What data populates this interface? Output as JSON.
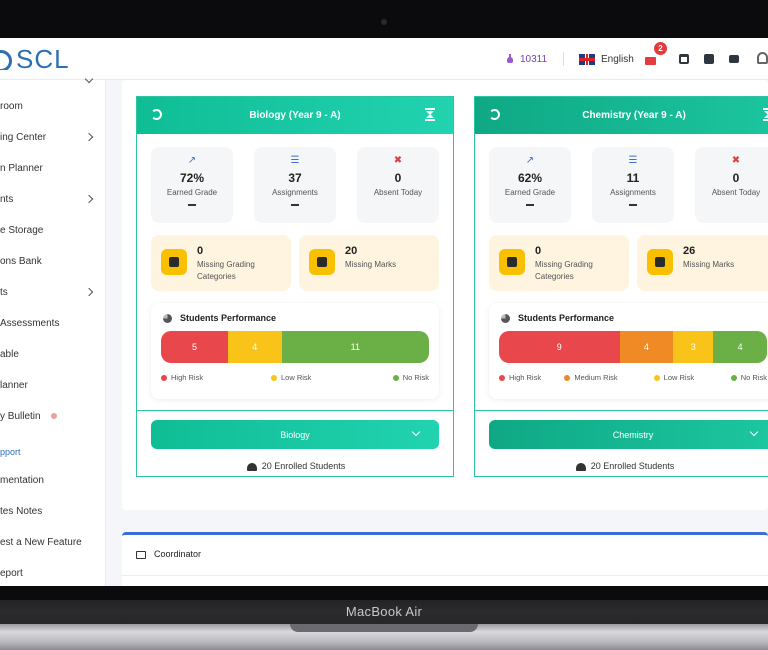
{
  "device": {
    "label": "MacBook Air"
  },
  "header": {
    "logo": "SCL",
    "points": "10311",
    "language": "English",
    "notifications": "2"
  },
  "sidebar": {
    "items": [
      "room",
      "ing Center",
      "n Planner",
      "nts",
      "e Storage",
      "ons Bank",
      "ts",
      "Assessments",
      "able",
      "lanner",
      "y Bulletin"
    ],
    "section": "pport",
    "support_items": [
      "mentation",
      "tes Notes",
      "est a New Feature",
      "eport"
    ]
  },
  "courses": [
    {
      "title": "Biology (Year 9 - A)",
      "stats": [
        {
          "icon": "chart-icon",
          "value": "72%",
          "label": "Earned Grade"
        },
        {
          "icon": "list-icon",
          "value": "37",
          "label": "Assignments"
        },
        {
          "icon": "user-x-icon",
          "value": "0",
          "label": "Absent Today"
        }
      ],
      "warnings": [
        {
          "value": "0",
          "label": "Missing Grading Categories"
        },
        {
          "value": "20",
          "label": "Missing Marks"
        }
      ],
      "performance": {
        "title": "Students Performance",
        "segments": [
          {
            "label": "5",
            "value": 5,
            "color": "#e8474c"
          },
          {
            "label": "4",
            "value": 4,
            "color": "#f9c319"
          },
          {
            "label": "11",
            "value": 11,
            "color": "#6ab046"
          }
        ],
        "legend": [
          {
            "label": "High Risk",
            "color": "#e8474c"
          },
          {
            "label": "Low Risk",
            "color": "#f9c319"
          },
          {
            "label": "No Risk",
            "color": "#6ab046"
          }
        ]
      },
      "button": "Biology",
      "enrolled": "20 Enrolled Students"
    },
    {
      "title": "Chemistry (Year 9 - A)",
      "stats": [
        {
          "icon": "chart-icon",
          "value": "62%",
          "label": "Earned Grade"
        },
        {
          "icon": "list-icon",
          "value": "11",
          "label": "Assignments"
        },
        {
          "icon": "user-x-icon",
          "value": "0",
          "label": "Absent Today"
        }
      ],
      "warnings": [
        {
          "value": "0",
          "label": "Missing Grading Categories"
        },
        {
          "value": "26",
          "label": "Missing Marks"
        }
      ],
      "performance": {
        "title": "Students Performance",
        "segments": [
          {
            "label": "9",
            "value": 9,
            "color": "#e8474c"
          },
          {
            "label": "4",
            "value": 4,
            "color": "#f08a24"
          },
          {
            "label": "3",
            "value": 3,
            "color": "#f9c319"
          },
          {
            "label": "4",
            "value": 4,
            "color": "#6ab046"
          }
        ],
        "legend": [
          {
            "label": "High Risk",
            "color": "#e8474c"
          },
          {
            "label": "Medium Risk",
            "color": "#f08a24"
          },
          {
            "label": "Low Risk",
            "color": "#f9c319"
          },
          {
            "label": "No Risk",
            "color": "#6ab046"
          }
        ]
      },
      "button": "Chemistry",
      "enrolled": "20 Enrolled Students"
    }
  ],
  "coordinator": {
    "title": "Coordinator"
  }
}
